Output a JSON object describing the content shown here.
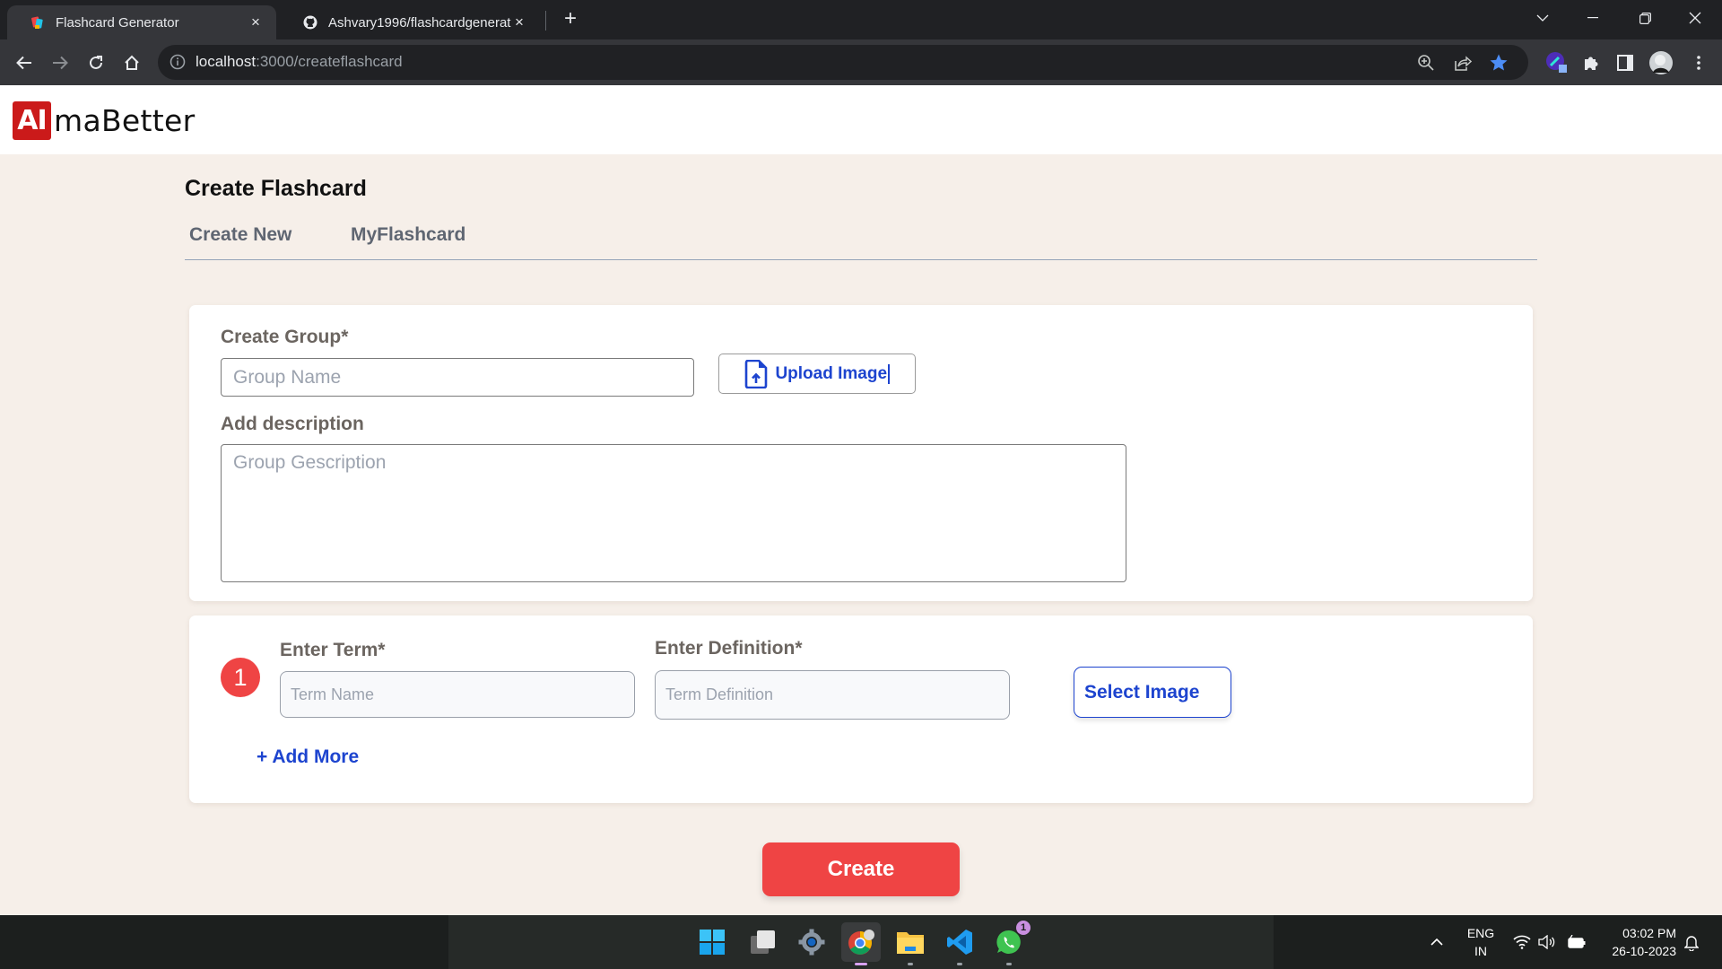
{
  "browser": {
    "tabs": [
      {
        "title": "Flashcard Generator",
        "active": true,
        "favicon": "flashcard-favicon"
      },
      {
        "title": "Ashvary1996/flashcardgenerator",
        "active": false,
        "favicon": "github-icon"
      }
    ],
    "tab_close": "×",
    "new_tab": "+",
    "url_host": "localhost",
    "url_path": ":3000/createflashcard"
  },
  "app": {
    "logo_box": "AI",
    "logo_text": "maBetter",
    "page_title": "Create Flashcard",
    "tabs": [
      "Create New",
      "MyFlashcard"
    ]
  },
  "group_card": {
    "group_label": "Create Group*",
    "group_placeholder": "Group Name",
    "upload_label": "Upload Image",
    "desc_label": "Add description",
    "desc_placeholder": "Group Gescription"
  },
  "term_card": {
    "terms": [
      {
        "number": "1",
        "term_label": "Enter Term*",
        "term_placeholder": "Term Name",
        "definition_label": "Enter Definition*",
        "definition_placeholder": "Term Definition",
        "select_image_label": "Select Image"
      }
    ],
    "add_more_label": "+ Add More"
  },
  "actions": {
    "create_label": "Create"
  },
  "colors": {
    "brand_red": "#cb1a1a",
    "accent_blue": "#1d44cf",
    "create_red": "#ef4444",
    "page_bg": "#f6efe9"
  },
  "taskbar": {
    "apps": [
      "start",
      "task-view",
      "settings",
      "chrome",
      "file-explorer",
      "vscode",
      "whatsapp"
    ],
    "whatsapp_badge": "1",
    "lang_top": "ENG",
    "lang_bottom": "IN",
    "time": "03:02 PM",
    "date": "26-10-2023"
  }
}
